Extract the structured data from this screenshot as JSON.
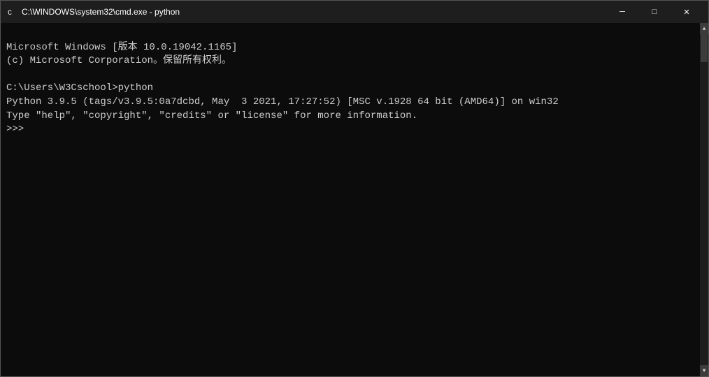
{
  "window": {
    "title": "C:\\WINDOWS\\system32\\cmd.exe - python"
  },
  "titlebar": {
    "minimize_label": "─",
    "maximize_label": "□",
    "close_label": "✕"
  },
  "console": {
    "line1": "Microsoft Windows [版本 10.0.19042.1165]",
    "line2": "(c) Microsoft Corporation。保留所有权利。",
    "line3": "",
    "line4": "C:\\Users\\W3Cschool>python",
    "line5": "Python 3.9.5 (tags/v3.9.5:0a7dcbd, May  3 2021, 17:27:52) [MSC v.1928 64 bit (AMD64)] on win32",
    "line6": "Type \"help\", \"copyright\", \"credits\" or \"license\" for more information.",
    "line7": ">>> "
  }
}
